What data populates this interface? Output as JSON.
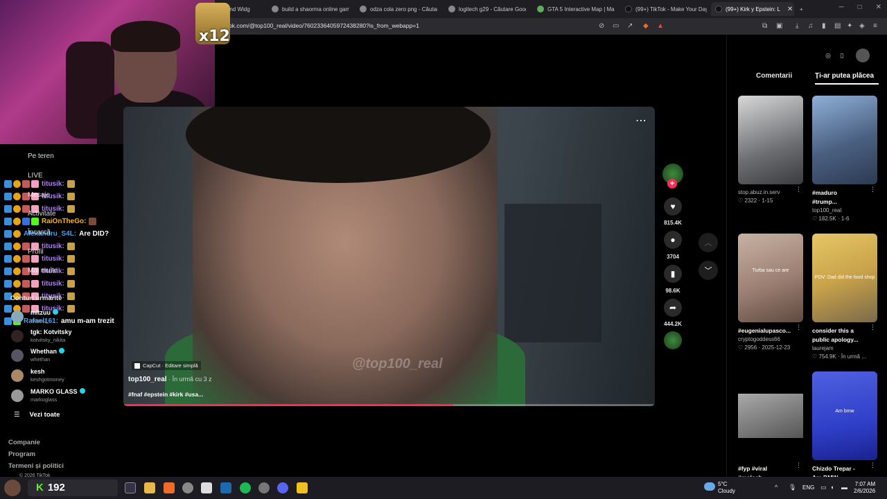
{
  "browser": {
    "tabs": [
      {
        "title": "ot and Widg"
      },
      {
        "title": "build a shaorma online game"
      },
      {
        "title": "odza cola zero png - Căutare"
      },
      {
        "title": "logitech g29 - Căutare Goog"
      },
      {
        "title": "GTA 5 Interactive Map | Map"
      },
      {
        "title": "(99+) TikTok - Make Your Day"
      },
      {
        "title": "(99+) Kirk y Epstein: L"
      }
    ],
    "url": "ok.com/@top100_real/video/7602336405972438280?is_from_webapp=1"
  },
  "stream_overlay": {
    "emote_multiplier": "x12",
    "chat": [
      {
        "user": "titusik:",
        "msg": "",
        "color": "#b07cff"
      },
      {
        "user": "titusik:",
        "msg": "",
        "color": "#b07cff"
      },
      {
        "user": "titusik:",
        "msg": "",
        "color": "#b07cff"
      },
      {
        "user": "RaiOnTheGo:",
        "msg": "",
        "color": "#ffb31a"
      },
      {
        "user": "Alexandru_S4L:",
        "msg": "Are DID?",
        "color": "#3fa0ff"
      },
      {
        "user": "titusik:",
        "msg": "",
        "color": "#b07cff"
      },
      {
        "user": "titusik:",
        "msg": "",
        "color": "#b07cff"
      },
      {
        "user": "titusik:",
        "msg": "",
        "color": "#b07cff"
      },
      {
        "user": "titusik:",
        "msg": "",
        "color": "#b07cff"
      },
      {
        "user": "titusik:",
        "msg": "",
        "color": "#b07cff"
      },
      {
        "user": "titusik:",
        "msg": "",
        "color": "#b07cff"
      },
      {
        "user": "Rafael161:",
        "msg": "amu m-am trezit",
        "color": "#3fa0ff"
      }
    ],
    "underlying_nav": [
      "Pe teren",
      "LIVE",
      "Mesaje",
      "Activitate",
      "Încarcă",
      "Profil",
      "Mai multe"
    ]
  },
  "sidebar": {
    "following_title": "Conturi urmărite",
    "accounts": [
      {
        "name": "mitzuu",
        "handle": "mitzuu_",
        "verified": true
      },
      {
        "name": "tgk: Kotvitsky",
        "handle": "kotvitsky_nikita",
        "verified": false
      },
      {
        "name": "Whethan",
        "handle": "whethan",
        "verified": true
      },
      {
        "name": "kesh",
        "handle": "keshgotmoney",
        "verified": false
      },
      {
        "name": "MARKO GLASS",
        "handle": "markoglass",
        "verified": true
      }
    ],
    "see_all": "Vezi toate",
    "footer_links": [
      "Companie",
      "Program",
      "Termeni și politici"
    ],
    "copyright": "© 2026 TikTok"
  },
  "video": {
    "capcut_label": "CapCut · Editare simplă",
    "author": "top100_real",
    "ago": " · În urmă cu 3 z",
    "hashtags": "#fnaf #epstein #kirk #usa...",
    "watermark": "@top100_real",
    "progress": 0.62
  },
  "actions": {
    "likes": "815.4K",
    "comments": "3704",
    "saves": "98.6K",
    "shares": "444.2K"
  },
  "right_panel": {
    "tab_comments": "Comentarii",
    "tab_like": "Ți-ar putea plăcea",
    "cards": [
      {
        "caption": "",
        "author": "stop.abuz.in.serv",
        "likes": "2322",
        "date": "1-15",
        "thumb": "#8d8f93",
        "overlay": ""
      },
      {
        "caption": "#maduro",
        "caption2": "#trump...",
        "author": "top100_real",
        "likes": "182.5K",
        "date": "1-6",
        "thumb": "#5a6e8a",
        "overlay": ""
      },
      {
        "caption": "#eugenialupasco...",
        "author": "cryptogoddess66",
        "likes": "2956",
        "date": "2025-12-23",
        "thumb": "#a4857a",
        "overlay": "Turba sau ce are"
      },
      {
        "caption": "consider this a",
        "caption2": "public apology...",
        "author": "laurejam",
        "likes": "754.9K",
        "date": "În urmă ...",
        "thumb": "#c9a24a",
        "overlay": "POV: Dad did the food shop"
      },
      {
        "caption": "#fyp #viral",
        "caption2": "#moloch",
        "author": "",
        "likes": "",
        "date": "",
        "thumb": "#6b6b6b",
        "overlay": ""
      },
      {
        "caption": "Chizdo Trepar -",
        "caption2": "Am BMW",
        "author": "",
        "likes": "",
        "date": "",
        "thumb": "#2f3fc8",
        "overlay": "Am bmw"
      }
    ]
  },
  "taskbar": {
    "score": "192",
    "weather_temp": "5°C",
    "weather_desc": "Cloudy",
    "lang": "ENG",
    "time": "7:07 AM",
    "date": "2/6/2026"
  }
}
